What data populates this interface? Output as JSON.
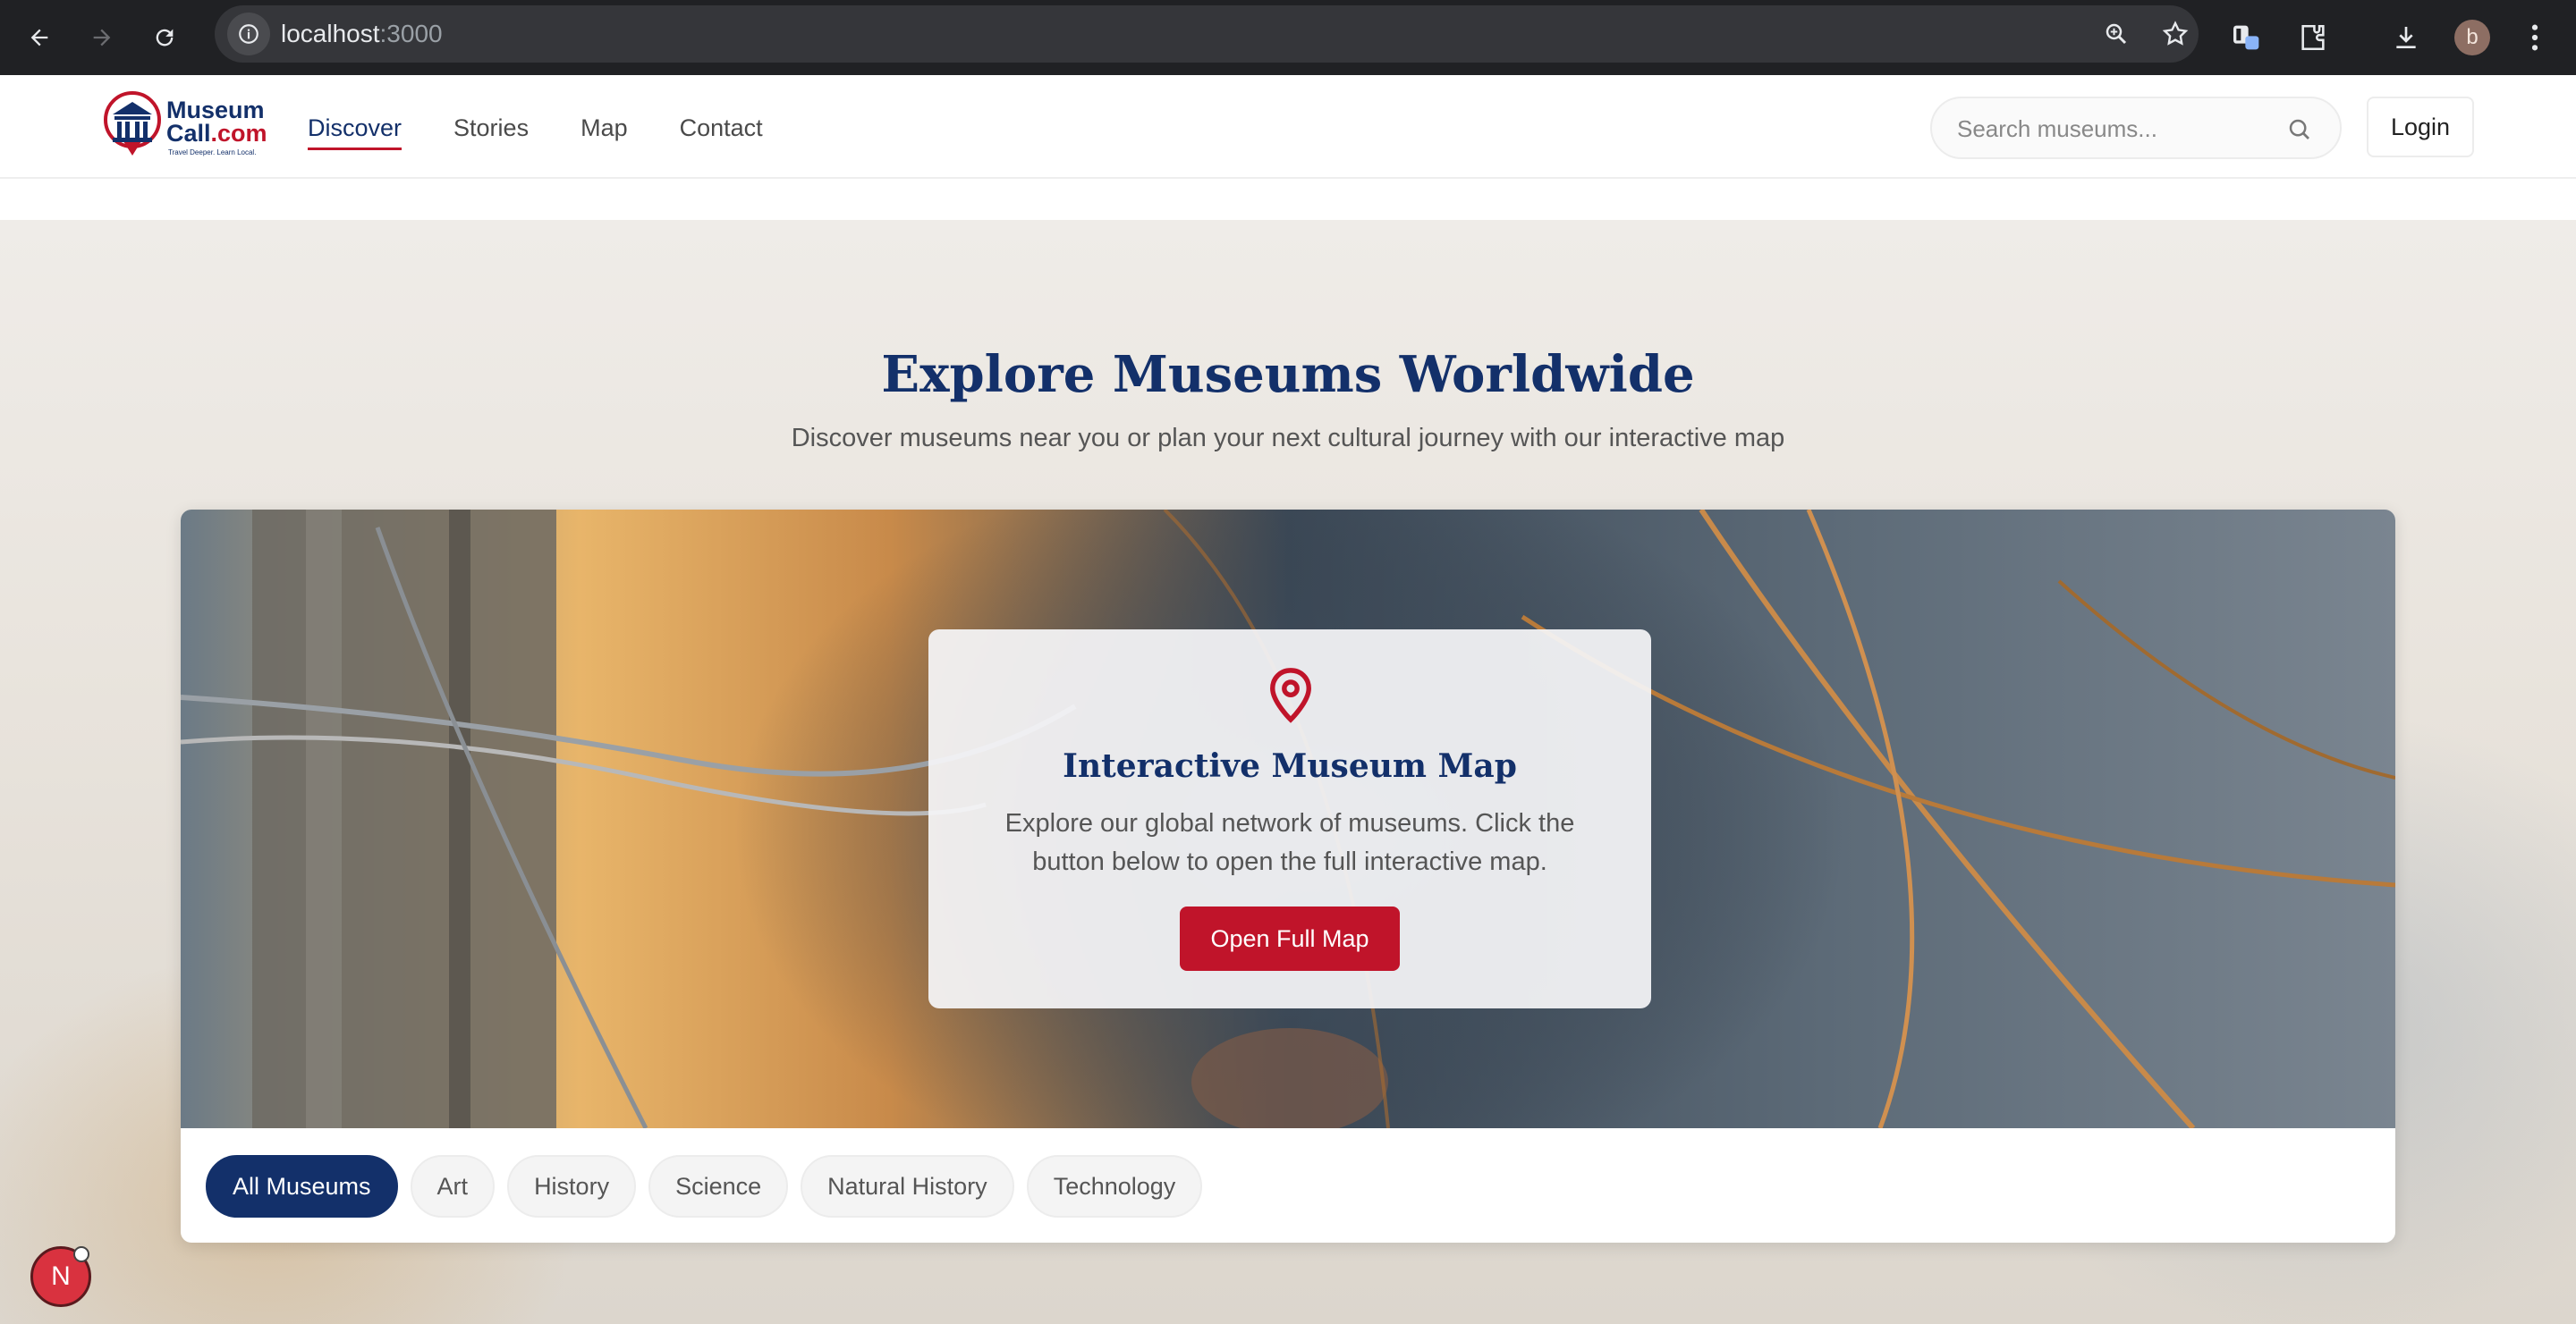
{
  "browser": {
    "url_host": "localhost",
    "url_port": ":3000",
    "profile_initial": "b"
  },
  "site": {
    "logo": {
      "line1": "Museum",
      "line2": "Call",
      "line2_suffix": ".com",
      "tagline": "Travel Deeper. Learn Local."
    },
    "nav": [
      {
        "label": "Discover",
        "active": true
      },
      {
        "label": "Stories",
        "active": false
      },
      {
        "label": "Map",
        "active": false
      },
      {
        "label": "Contact",
        "active": false
      }
    ],
    "search": {
      "placeholder": "Search museums..."
    },
    "login_label": "Login"
  },
  "hero": {
    "title": "Explore Museums Worldwide",
    "subtitle": "Discover museums near you or plan your next cultural journey with our interactive map"
  },
  "map_card": {
    "overlay_title": "Interactive Museum Map",
    "overlay_text": "Explore our global network of museums. Click the button below to open the full interactive map.",
    "button_label": "Open Full Map",
    "filters": [
      {
        "label": "All Museums",
        "active": true
      },
      {
        "label": "Art",
        "active": false
      },
      {
        "label": "History",
        "active": false
      },
      {
        "label": "Science",
        "active": false
      },
      {
        "label": "Natural History",
        "active": false
      },
      {
        "label": "Technology",
        "active": false
      }
    ]
  },
  "floating_badge": {
    "letter": "N"
  },
  "colors": {
    "brand_navy": "#13306a",
    "brand_red": "#c0142a"
  }
}
